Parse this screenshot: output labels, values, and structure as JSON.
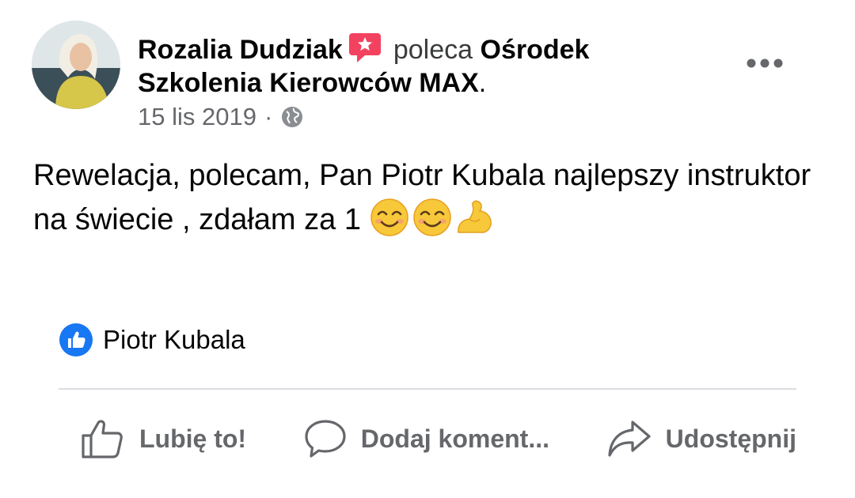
{
  "post": {
    "author_name": "Rozalia Dudziak",
    "action_text": "poleca",
    "page_name": "Ośrodek Szkolenia Kierowców MAX",
    "page_suffix": ".",
    "date": "15 lis 2019",
    "date_separator": "·",
    "privacy_icon": "globe-icon",
    "body_text": "Rewelacja, polecam, Pan Piotr Kubala najlepszy instruktor na świecie , zdałam za 1",
    "body_emojis": [
      "smiling-face-icon",
      "smiling-face-icon",
      "flexed-biceps-icon"
    ]
  },
  "reactions": {
    "icon": "like-icon",
    "names": "Piotr Kubala"
  },
  "actions": {
    "like_label": "Lubię to!",
    "comment_label": "Dodaj koment...",
    "share_label": "Udostępnij"
  },
  "colors": {
    "text_primary": "#050505",
    "text_secondary": "#65676b",
    "recommend_red": "#f3425f",
    "like_blue": "#1877f2",
    "divider": "#dadde1"
  }
}
